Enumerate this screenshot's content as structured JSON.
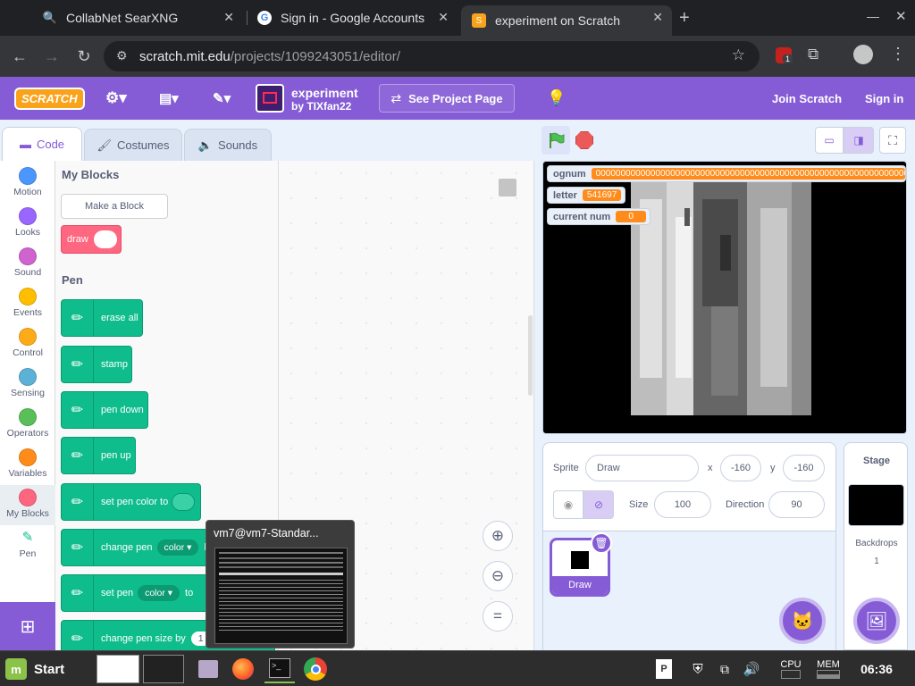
{
  "browser": {
    "tabs": [
      {
        "title": "CollabNet SearXNG"
      },
      {
        "title": "Sign in - Google Accounts"
      },
      {
        "title": "experiment on Scratch"
      }
    ],
    "url_host": "scratch.mit.edu",
    "url_path": "/projects/1099243051/editor/",
    "ext_badge": "1"
  },
  "menubar": {
    "logo": "SCRATCH",
    "project_title": "experiment",
    "author": "by TIXfan22",
    "see_project": "See Project Page",
    "join": "Join Scratch",
    "signin": "Sign in"
  },
  "editor_tabs": {
    "code": "Code",
    "costumes": "Costumes",
    "sounds": "Sounds"
  },
  "categories": [
    {
      "label": "Motion",
      "color": "#4c97ff"
    },
    {
      "label": "Looks",
      "color": "#9966ff"
    },
    {
      "label": "Sound",
      "color": "#cf63cf"
    },
    {
      "label": "Events",
      "color": "#ffbf00"
    },
    {
      "label": "Control",
      "color": "#ffab19"
    },
    {
      "label": "Sensing",
      "color": "#5cb1d6"
    },
    {
      "label": "Operators",
      "color": "#59c059"
    },
    {
      "label": "Variables",
      "color": "#ff8c1a"
    },
    {
      "label": "My Blocks",
      "color": "#ff6680"
    },
    {
      "label": "Pen",
      "color": ""
    }
  ],
  "palette": {
    "myblocks_title": "My Blocks",
    "make_block": "Make a Block",
    "draw_block": "draw",
    "pen_title": "Pen",
    "pen_blocks": [
      {
        "label": "erase all"
      },
      {
        "label": "stamp"
      },
      {
        "label": "pen down"
      },
      {
        "label": "pen up"
      },
      {
        "label": "set pen color to"
      },
      {
        "label": "change pen",
        "dropdown": "color ▾",
        "suffix": "by"
      },
      {
        "label": "set pen",
        "dropdown": "color ▾",
        "suffix": "to"
      },
      {
        "label": "change pen size by",
        "value": "1"
      }
    ]
  },
  "monitors": [
    {
      "name": "ognum",
      "value": "0000000000000000000000000000000000000000000000000000000000000000000000000000"
    },
    {
      "name": "letter",
      "value": "541697"
    },
    {
      "name": "current num",
      "value": "0"
    }
  ],
  "sprite_info": {
    "sprite_label": "Sprite",
    "sprite_name": "Draw",
    "x_label": "x",
    "x": "-160",
    "y_label": "y",
    "y": "-160",
    "size_label": "Size",
    "size": "100",
    "direction_label": "Direction",
    "direction": "90",
    "thumb_name": "Draw"
  },
  "stage_info": {
    "title": "Stage",
    "backdrops_label": "Backdrops",
    "backdrops_count": "1"
  },
  "terminal_popup": {
    "title": "vm7@vm7-Standar..."
  },
  "taskbar": {
    "start": "Start",
    "cpu": "CPU",
    "mem": "MEM",
    "clock": "06:36"
  }
}
